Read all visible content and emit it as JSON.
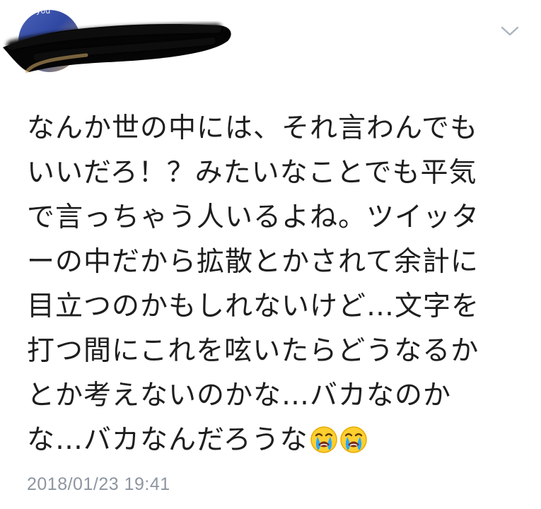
{
  "header": {
    "avatar_badge_text": "you",
    "menu_icon": "chevron-down-icon"
  },
  "tweet": {
    "lines": [
      "なんか世の中には、それ言わんでも",
      "いいだろ！？みたいなことでも平気",
      "で言っちゃう人いるよね。ツイッタ",
      "ーの中だから拡散とかされて余計に",
      "目立つのかもしれないけど…文字を",
      "打つ間にこれを呟いたらどうなるか",
      "とか考えないのかな…バカなのか",
      "な…バカなんだろうな"
    ],
    "emoji": [
      "crying-face-icon",
      "crying-face-icon"
    ]
  },
  "timestamp": "2018/01/23 19:41",
  "colors": {
    "text": "#1e1e1e",
    "muted": "#8d96a0",
    "background": "#ffffff"
  }
}
